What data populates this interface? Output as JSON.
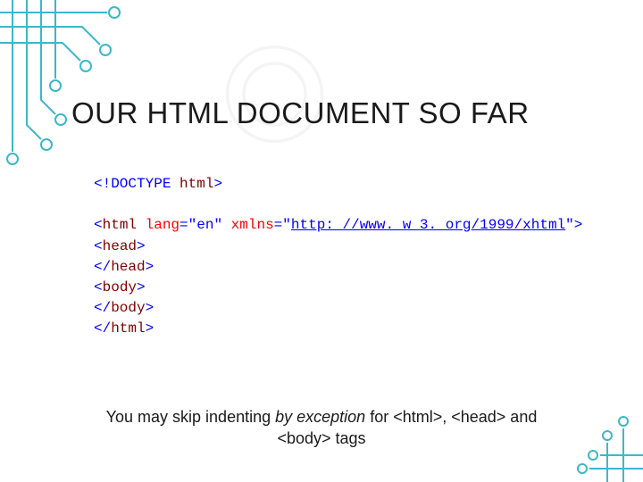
{
  "title": "OUR HTML DOCUMENT SO FAR",
  "code": {
    "l1": {
      "open": "<!",
      "doctype": "DOCTYPE",
      "space": " ",
      "html": "html",
      "close": ">"
    },
    "l2": {
      "open": "<",
      "tag": "html",
      "sp1": " ",
      "attr1": "lang",
      "eq1": "=\"en\"",
      "sp2": " ",
      "attr2": "xmlns",
      "eq2": "=",
      "q1": "\"",
      "url": "http: //www. w 3. org/1999/xhtml",
      "q2": "\"",
      "close": ">"
    },
    "l3": {
      "open": "<",
      "tag": "head",
      "close": ">"
    },
    "l4": {
      "open": "</",
      "tag": "head",
      "close": ">"
    },
    "l5": {
      "open": "<",
      "tag": "body",
      "close": ">"
    },
    "l6": {
      "open": "</",
      "tag": "body",
      "close": ">"
    },
    "l7": {
      "open": "</",
      "tag": "html",
      "close": ">"
    }
  },
  "note": {
    "p1": "You may skip indenting ",
    "em": "by exception",
    "p2": " for <html>, <head> and",
    "p3": "<body> tags"
  }
}
